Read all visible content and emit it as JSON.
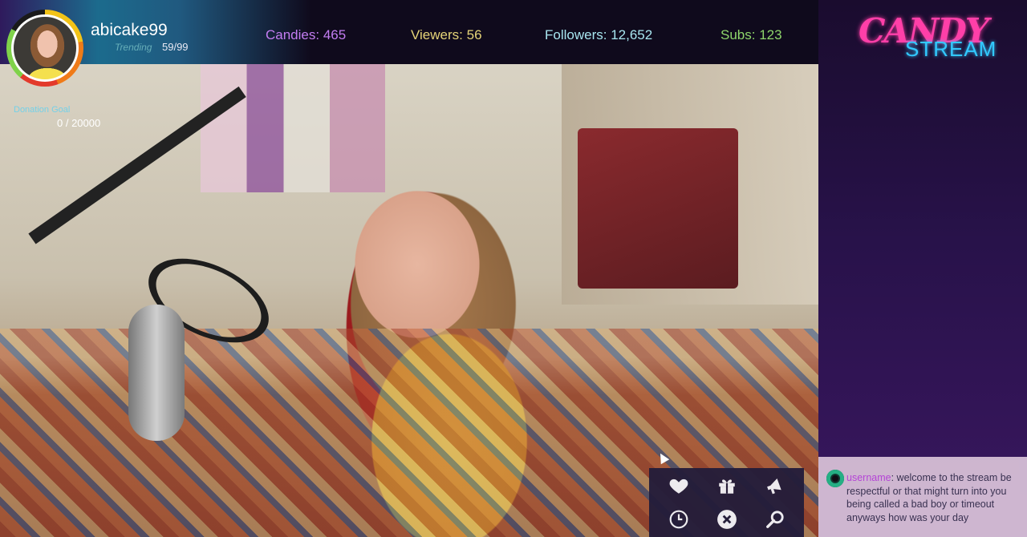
{
  "user": {
    "name": "abicake99",
    "trending_label": "Trending",
    "trending_value": "59/99"
  },
  "stats": [
    {
      "label": "Candies:",
      "value": "465",
      "color": "#c37df2"
    },
    {
      "label": "Viewers:",
      "value": "56",
      "color": "#e5d478"
    },
    {
      "label": "Followers:",
      "value": "12,652",
      "color": "#a8e6f0"
    },
    {
      "label": "Subs:",
      "value": "123",
      "color": "#8ed56b"
    }
  ],
  "donation": {
    "label": "Donation Goal",
    "value": "0 / 20000"
  },
  "logo": {
    "top": "CANDY",
    "bottom": "STREAM"
  },
  "chat": {
    "username": "username",
    "message": ": welcome to the stream be respectful or that might turn into you being called a bad boy or timeout anyways how was your day"
  },
  "actions": [
    {
      "icon": "heart-icon"
    },
    {
      "icon": "gift-icon"
    },
    {
      "icon": "megaphone-icon"
    },
    {
      "icon": "clock-icon"
    },
    {
      "icon": "close-icon"
    },
    {
      "icon": "search-icon"
    }
  ],
  "colors": {
    "accent_pink": "#ff3fa8",
    "accent_cyan": "#32c9ff",
    "panel": "#1a0c2e"
  }
}
